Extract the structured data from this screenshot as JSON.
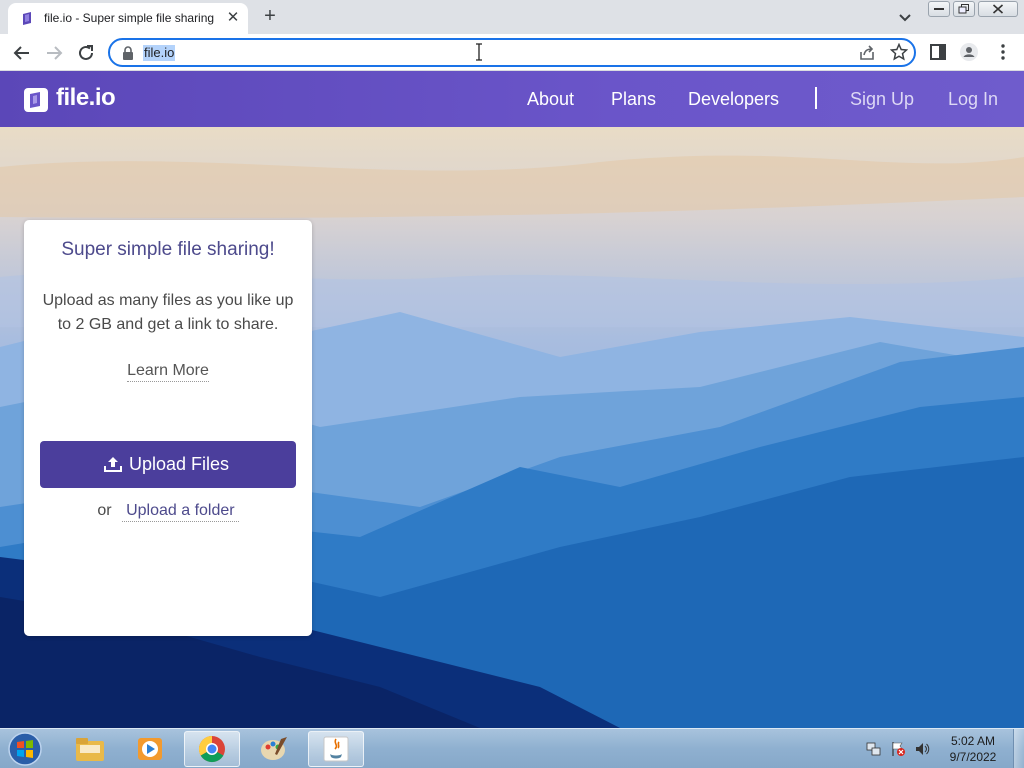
{
  "browser": {
    "tab_title": "file.io - Super simple file sharing",
    "new_tab_symbol": "+",
    "close_symbol": "✕",
    "url": "file.io"
  },
  "site": {
    "logo_text": "file.io",
    "nav": {
      "about": "About",
      "plans": "Plans",
      "developers": "Developers",
      "sign_up": "Sign Up",
      "log_in": "Log In"
    },
    "accent_color": "#4b3e9c"
  },
  "card": {
    "title": "Super simple file sharing!",
    "description": "Upload as many files as you like up to 2 GB and get a link to share.",
    "learn_more": "Learn More",
    "upload_button": "Upload Files",
    "or_text": "or",
    "upload_folder": "Upload a folder"
  },
  "taskbar": {
    "time": "5:02 AM",
    "date": "9/7/2022",
    "apps": [
      "file-explorer-icon",
      "media-player-icon",
      "chrome-icon",
      "paint-icon",
      "java-icon"
    ]
  }
}
